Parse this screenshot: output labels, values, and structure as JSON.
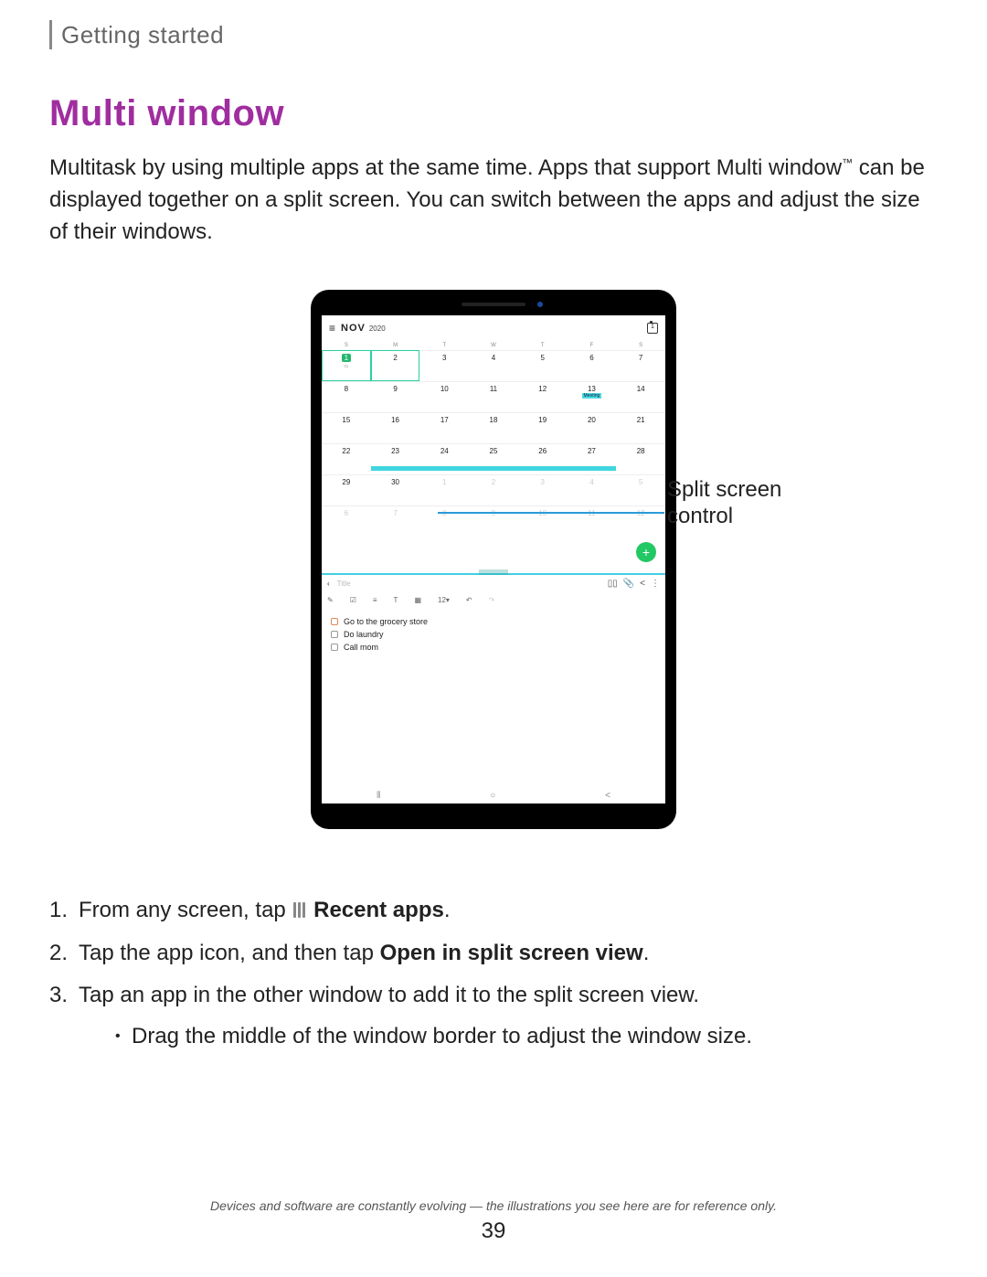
{
  "breadcrumb": "Getting started",
  "heading": "Multi window",
  "intro_part1": "Multitask by using multiple apps at the same time. Apps that support Multi window",
  "intro_tm": "™",
  "intro_part2": " can be displayed together on a split screen. You can switch between the apps and adjust the size of their windows.",
  "callout": "Split screen control",
  "tablet": {
    "cal": {
      "month": "NOV",
      "year": "2020",
      "today_icon": "1",
      "dow": [
        "S",
        "M",
        "T",
        "W",
        "T",
        "F",
        "S"
      ],
      "row1": [
        "1",
        "2",
        "3",
        "4",
        "5",
        "6",
        "7"
      ],
      "row2": [
        "8",
        "9",
        "10",
        "11",
        "12",
        "13",
        "14"
      ],
      "meeting": "Meeting",
      "row3": [
        "15",
        "16",
        "17",
        "18",
        "19",
        "20",
        "21"
      ],
      "row4": [
        "22",
        "23",
        "24",
        "25",
        "26",
        "27",
        "28"
      ],
      "row5": [
        "29",
        "30",
        "1",
        "2",
        "3",
        "4",
        "5"
      ],
      "row6": [
        "6",
        "7",
        "8",
        "9",
        "10",
        "11",
        "12"
      ]
    },
    "notes": {
      "back": "‹",
      "title_placeholder": "Title",
      "tool_size": "12",
      "items": [
        "Go to the grocery store",
        "Do laundry",
        "Call mom"
      ]
    }
  },
  "steps": {
    "s1a": "From any screen, tap",
    "s1b": "Recent apps",
    "s1c": ".",
    "s2a": "Tap the app icon, and then tap ",
    "s2b": "Open in split screen view",
    "s2c": ".",
    "s3": "Tap an app in the other window to add it to the split screen view.",
    "bullet": "Drag the middle of the window border to adjust the window size."
  },
  "footer": "Devices and software are constantly evolving — the illustrations you see here are for reference only.",
  "page_number": "39"
}
